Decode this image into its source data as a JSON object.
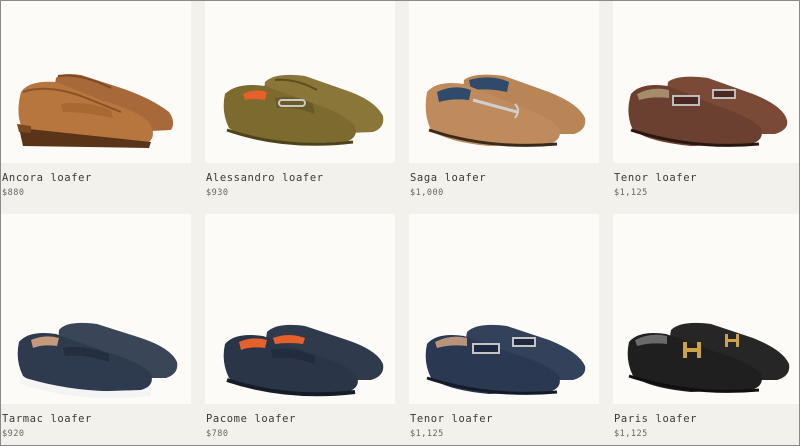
{
  "products": [
    {
      "name": "Ancora loafer",
      "price": "$880",
      "image": "tan-leather-penny-loafer"
    },
    {
      "name": "Alessandro loafer",
      "price": "$930",
      "image": "olive-suede-driving-loafer"
    },
    {
      "name": "Saga loafer",
      "price": "$1,000",
      "image": "tan-suede-bit-loafer"
    },
    {
      "name": "Tenor loafer",
      "price": "$1,125",
      "image": "brown-leather-buckle-loafer"
    },
    {
      "name": "Tarmac loafer",
      "price": "$920",
      "image": "navy-sport-loafer"
    },
    {
      "name": "Pacome loafer",
      "price": "$780",
      "image": "navy-driving-loafer"
    },
    {
      "name": "Tenor loafer",
      "price": "$1,125",
      "image": "navy-leather-buckle-loafer"
    },
    {
      "name": "Paris loafer",
      "price": "$1,125",
      "image": "black-leather-h-loafer"
    }
  ],
  "colors": {
    "tan": "#b3713f",
    "olive": "#7a6a32",
    "tan_suede": "#c08b5c",
    "brown": "#6b4030",
    "navy": "#2e3a4e",
    "black": "#1f1f1f",
    "orange_lining": "#e5602a",
    "background": "#f3f1ec",
    "card": "#fcfbf8"
  }
}
